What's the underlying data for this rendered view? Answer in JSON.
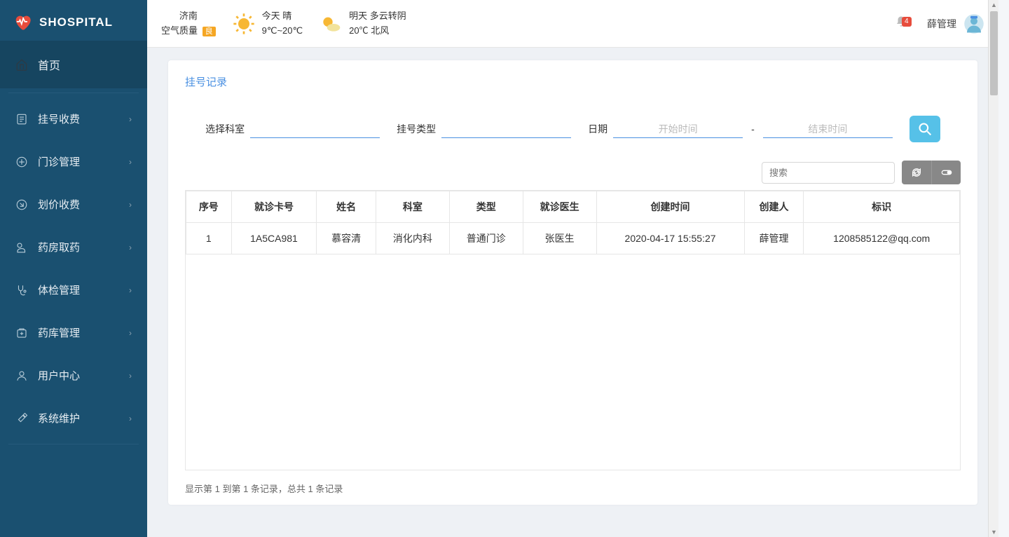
{
  "brand": "SHOSPITAL",
  "sidebar": {
    "home": "首页",
    "items": [
      {
        "label": "挂号收费"
      },
      {
        "label": "门诊管理"
      },
      {
        "label": "划价收费"
      },
      {
        "label": "药房取药"
      },
      {
        "label": "体检管理"
      },
      {
        "label": "药库管理"
      },
      {
        "label": "用户中心"
      },
      {
        "label": "系统维护"
      }
    ]
  },
  "weather": {
    "city": "济南",
    "aqi_label": "空气质量",
    "aqi_value": "良",
    "today_label": "今天 晴",
    "today_temp": "9℃~20℃",
    "tomorrow_label": "明天 多云转阴",
    "tomorrow_temp": "20℃ 北风"
  },
  "header": {
    "notif_count": "4",
    "username": "薛管理"
  },
  "page": {
    "title": "挂号记录",
    "filters": {
      "dept_label": "选择科室",
      "type_label": "挂号类型",
      "date_label": "日期",
      "start_placeholder": "开始时间",
      "end_placeholder": "结束时间"
    },
    "search_placeholder": "搜索",
    "columns": [
      "序号",
      "就诊卡号",
      "姓名",
      "科室",
      "类型",
      "就诊医生",
      "创建时间",
      "创建人",
      "标识"
    ],
    "rows": [
      {
        "no": "1",
        "card": "1A5CA981",
        "name": "慕容清",
        "dept": "消化内科",
        "type": "普通门诊",
        "doctor": "张医生",
        "created": "2020-04-17 15:55:27",
        "creator": "薛管理",
        "mark": "1208585122@qq.com"
      }
    ],
    "pager": "显示第 1 到第 1 条记录，总共 1 条记录"
  }
}
